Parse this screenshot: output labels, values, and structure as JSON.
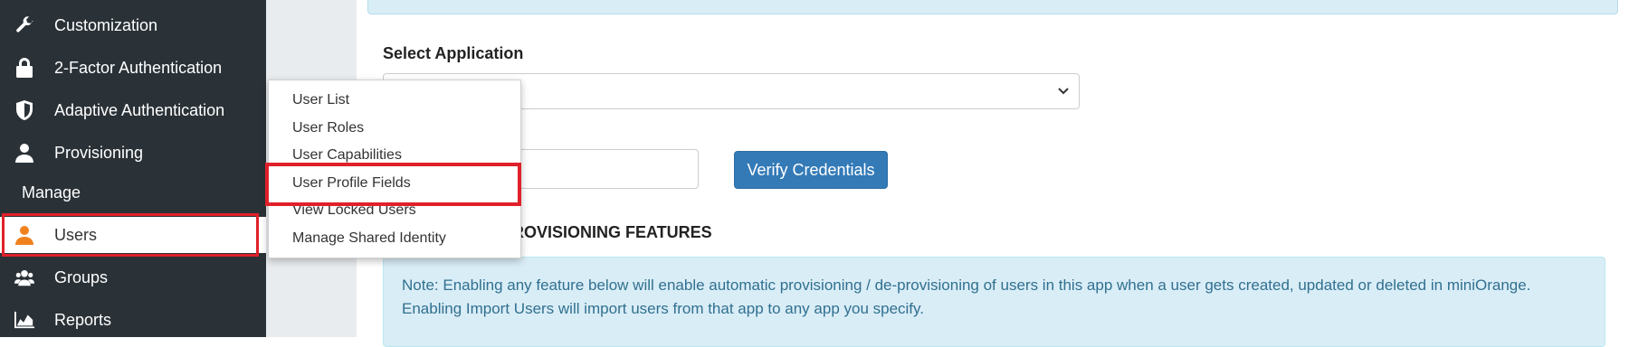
{
  "sidebar": {
    "items": [
      {
        "label": "Customization",
        "icon": "wrench-icon"
      },
      {
        "label": "2-Factor Authentication",
        "icon": "lock-icon"
      },
      {
        "label": "Adaptive Authentication",
        "icon": "shield-icon"
      },
      {
        "label": "Provisioning",
        "icon": "user-icon"
      }
    ],
    "section_label": "Manage",
    "manage_items": [
      {
        "label": "Users",
        "icon": "user-icon",
        "icon_color": "#f0821e",
        "active": true
      },
      {
        "label": "Groups",
        "icon": "users-icon"
      },
      {
        "label": "Reports",
        "icon": "area-chart-icon"
      }
    ]
  },
  "users_menu": {
    "items": [
      "User List",
      "User Roles",
      "User Capabilities",
      "User Profile Fields",
      "View Locked Users",
      "Manage Shared Identity"
    ],
    "highlighted": "User Profile Fields"
  },
  "main": {
    "select_application_label": "Select Application",
    "select_value": "",
    "credential_input_value": "",
    "verify_button_label": "Verify Credentials",
    "section_heading": "ROVISIONING FEATURES",
    "note_line1": "Note: Enabling any feature below will enable automatic provisioning / de-provisioning of users in this app when a user gets created, updated or deleted in miniOrange.",
    "note_line2": "Enabling Import Users will import users from that app to any app you specify."
  },
  "colors": {
    "sidebar_bg": "#2a3238",
    "accent_blue": "#337ab7",
    "highlight_red": "#e0202a",
    "info_bg": "#d9edf7",
    "info_text": "#31708f"
  }
}
